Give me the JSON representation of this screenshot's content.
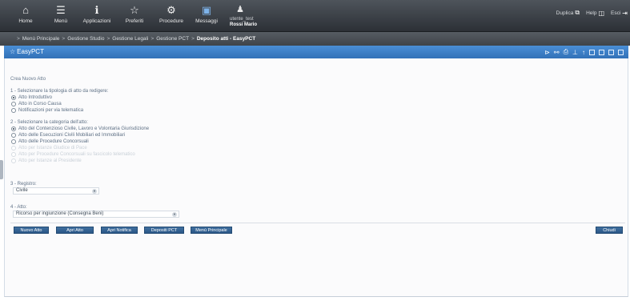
{
  "toolbar": {
    "items": [
      {
        "label": "Home",
        "icon": "home-icon",
        "glyph": "⌂"
      },
      {
        "label": "Menù",
        "icon": "menu-icon",
        "glyph": "☰"
      },
      {
        "label": "Applicazioni",
        "icon": "applications-icon",
        "glyph": "ℹ"
      },
      {
        "label": "Preferiti",
        "icon": "star-icon",
        "glyph": "☆"
      },
      {
        "label": "Procedure",
        "icon": "gear-icon",
        "glyph": "⚙"
      },
      {
        "label": "Messaggi",
        "icon": "messages-icon",
        "glyph": "▣"
      }
    ],
    "user": {
      "icon": "user-icon",
      "glyph": "♟",
      "line1": "utente_test",
      "line2": "Rossi Mario"
    },
    "right": {
      "duplica": "Duplica",
      "help": "Help",
      "esci": "Esci"
    }
  },
  "breadcrumb": {
    "items": [
      "Menù Principale",
      "Gestione Studio",
      "Gestione Legali",
      "Gestione PCT"
    ],
    "current": "Deposito atti - EasyPCT",
    "separator": ">"
  },
  "window": {
    "title": "EasyPCT",
    "star": "☆"
  },
  "form": {
    "subtitle": "Crea Nuovo Atto",
    "section1": {
      "title": "1 - Selezionare la tipologia di atto da redigere:",
      "options": [
        {
          "label": "Atto Introduttivo",
          "selected": true,
          "disabled": false
        },
        {
          "label": "Atto in Corso Causa",
          "selected": false,
          "disabled": false
        },
        {
          "label": "Notificazioni per via telematica",
          "selected": false,
          "disabled": false
        }
      ]
    },
    "section2": {
      "title": "2 - Selezionare la categoria dell'atto:",
      "options": [
        {
          "label": "Atto del Contenzioso Civile, Lavoro e Volontaria Giurisdizione",
          "selected": true,
          "disabled": false
        },
        {
          "label": "Atto delle Esecuzioni Civili Mobiliari ed Immobiliari",
          "selected": false,
          "disabled": false
        },
        {
          "label": "Atto delle Procedure Concorsuali",
          "selected": false,
          "disabled": false
        },
        {
          "label": "Atto per Istanze Giudice di Pace",
          "selected": false,
          "disabled": true
        },
        {
          "label": "Atto per Procedure Concorsuali su fascicolo telematico",
          "selected": false,
          "disabled": true
        },
        {
          "label": "Atto per Istanze al Presidente",
          "selected": false,
          "disabled": true
        }
      ]
    },
    "section3": {
      "title": "3 - Registro:",
      "value": "Civile"
    },
    "section4": {
      "title": "4 - Atto:",
      "value": "Ricorso per ingiunzione (Consegna Beni)"
    }
  },
  "buttons": {
    "nuovo": "Nuovo Atto",
    "apri": "Apri Atto",
    "notifica": "Apri Notifica",
    "depositi": "Depositi PCT",
    "menu": "Menù Principale",
    "chiudi": "Chiudi"
  },
  "colors": {
    "accent": "#3271b8",
    "button": "#2a5787",
    "toolbar": "#2c3036"
  }
}
